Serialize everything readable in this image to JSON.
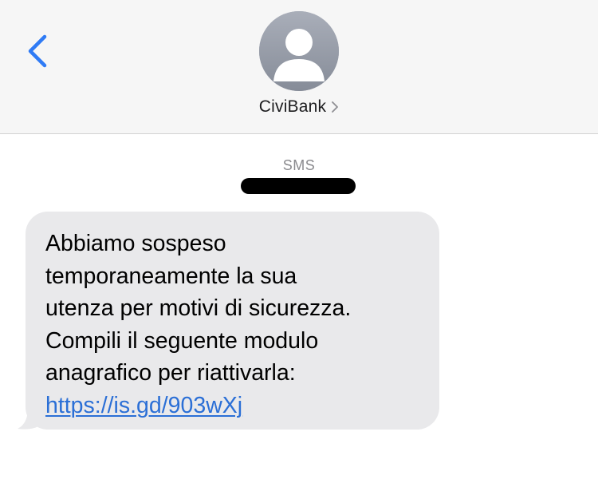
{
  "header": {
    "back_icon": "chevron-left-icon",
    "avatar_icon": "person-silhouette-icon",
    "contact_name": "CiviBank",
    "contact_chevron_icon": "chevron-right-icon"
  },
  "thread": {
    "service_label": "SMS",
    "redacted_timestamp": true,
    "messages": [
      {
        "direction": "incoming",
        "text": "Abbiamo sospeso\ntemporaneamente la sua\nutenza per motivi di sicurezza.\nCompili il seguente modulo\nanagrafico per riattivarla:",
        "link": "https://is.gd/903wXj"
      }
    ]
  },
  "colors": {
    "accent": "#2b6fd6",
    "bubble_incoming": "#e9e9eb",
    "header_bg": "#f6f6f6",
    "avatar_bg": "#a3a8b4"
  }
}
